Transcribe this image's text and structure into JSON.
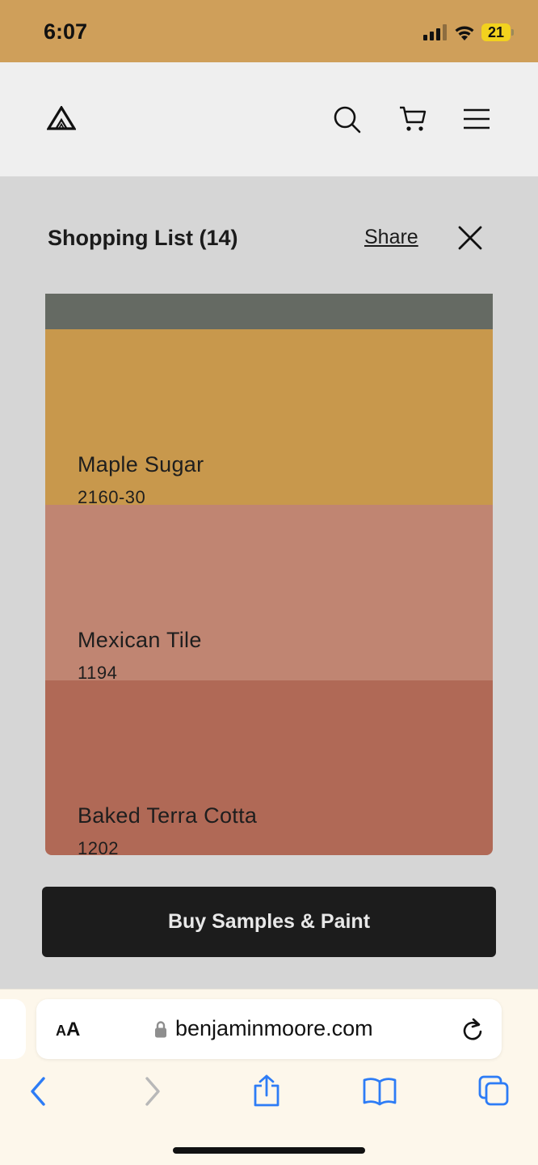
{
  "status_bar": {
    "time": "6:07",
    "battery": "21",
    "background": "#cf9f5a"
  },
  "header": {
    "logo_icon": "benjamin-moore-triangle-logo",
    "icons": [
      "search-icon",
      "cart-icon",
      "menu-icon"
    ]
  },
  "shopping_list": {
    "title": "Shopping List (14)",
    "share_label": "Share",
    "close_icon": "close-icon"
  },
  "swatches": [
    {
      "name": "",
      "code": "",
      "color": "#656a63"
    },
    {
      "name": "Maple Sugar",
      "code": "2160-30",
      "color": "#c8984c"
    },
    {
      "name": "Mexican Tile",
      "code": "1194",
      "color": "#c08572"
    },
    {
      "name": "Baked Terra Cotta",
      "code": "1202",
      "color": "#b06956"
    }
  ],
  "buy_button": {
    "label": "Buy Samples & Paint"
  },
  "browser": {
    "text_size_label_small": "A",
    "text_size_label_large": "A",
    "url": "benjaminmoore.com",
    "toolbar": [
      "back-icon",
      "forward-icon",
      "share-icon",
      "bookmarks-icon",
      "tabs-icon"
    ]
  }
}
